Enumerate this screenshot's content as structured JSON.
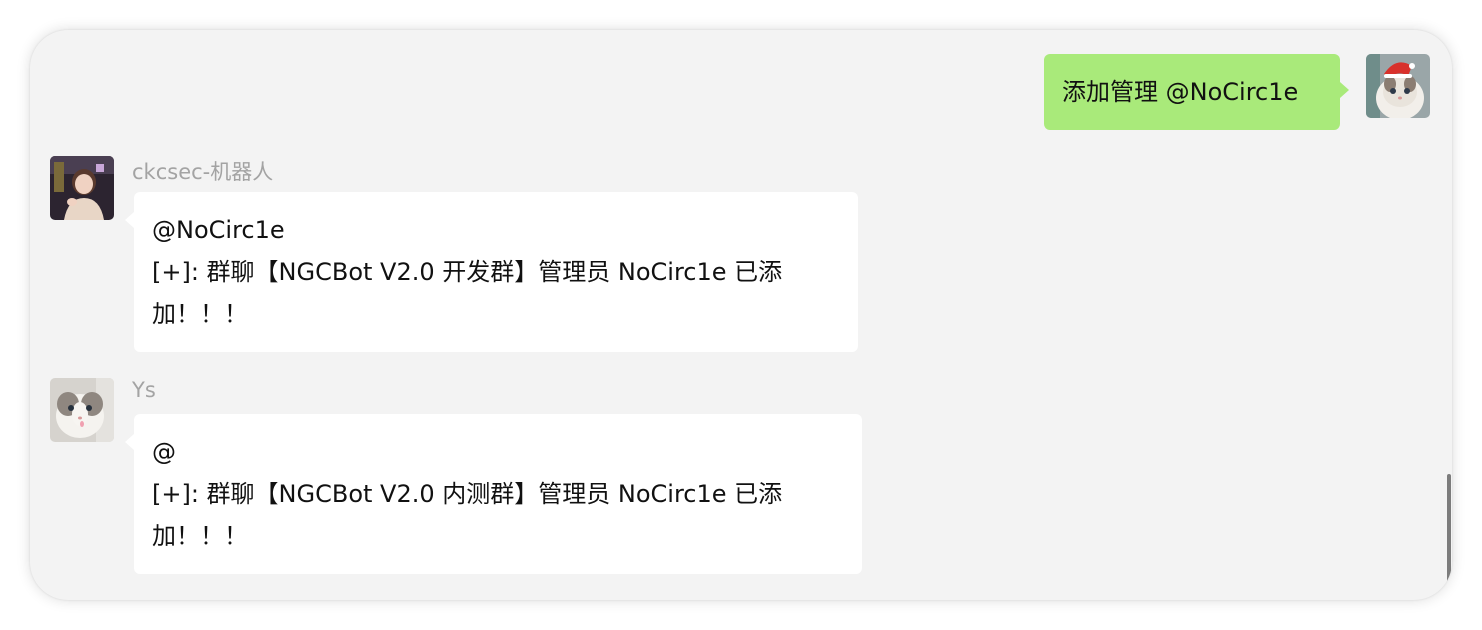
{
  "messages": [
    {
      "id": "self-1",
      "from_self": true,
      "text": "添加管理 @NoCirc1e"
    },
    {
      "id": "bot-1",
      "from_self": false,
      "sender": "ckcsec-机器人",
      "lines": [
        "@NoCirc1e",
        "[+]: 群聊【NGCBot V2.0 开发群】管理员 NoCirc1e 已添",
        "加！！！"
      ]
    },
    {
      "id": "ys-1",
      "from_self": false,
      "sender": "Ys",
      "lines": [
        "@",
        "[+]: 群聊【NGCBot V2.0 内测群】管理员 NoCirc1e 已添",
        "加！！！"
      ]
    }
  ],
  "colors": {
    "chat_background": "#f3f3f3",
    "self_bubble": "#a9ea7a",
    "other_bubble": "#ffffff",
    "sender_name": "#a3a3a3"
  },
  "icons": {
    "self_avatar": "cat-with-santa-hat-avatar",
    "bot_avatar": "girl-photo-avatar",
    "ys_avatar": "ragdoll-cat-avatar"
  }
}
